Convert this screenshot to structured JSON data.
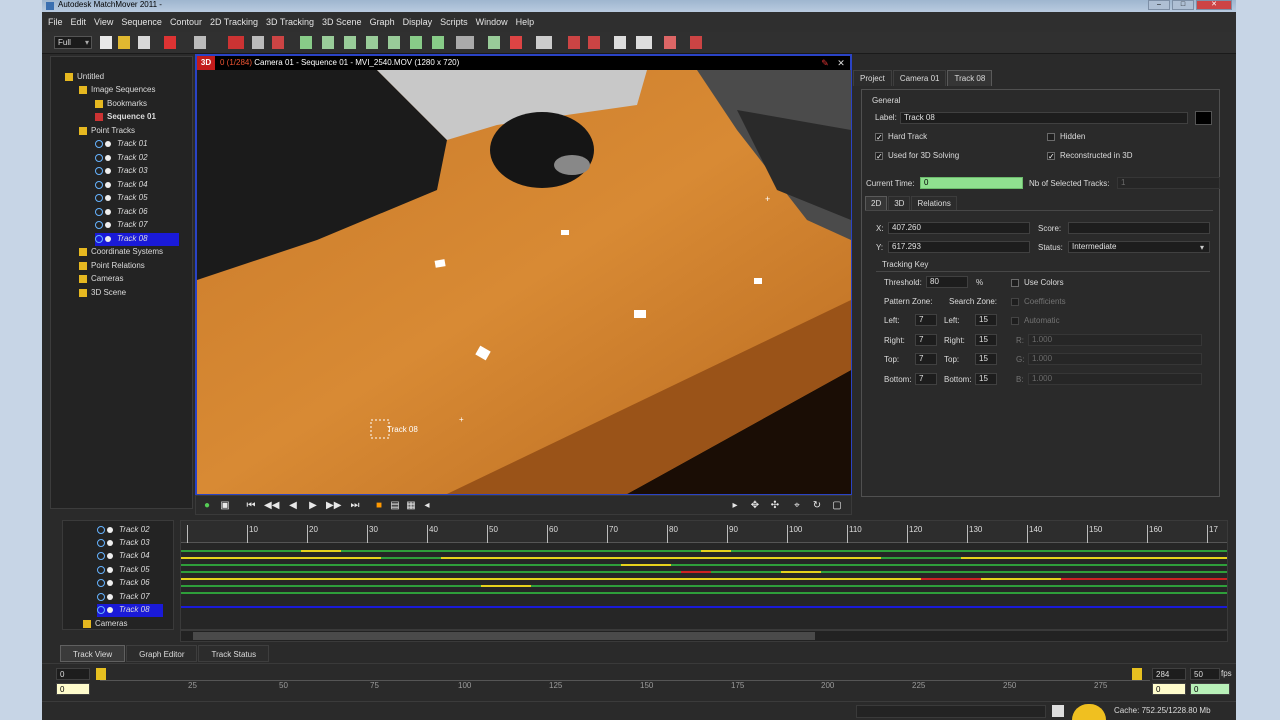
{
  "window": {
    "title": "Autodesk MatchMover 2011 -"
  },
  "menu": [
    "File",
    "Edit",
    "View",
    "Sequence",
    "Contour",
    "2D Tracking",
    "3D Tracking",
    "3D Scene",
    "Graph",
    "Display",
    "Scripts",
    "Window",
    "Help"
  ],
  "toolbar": {
    "zoom_value": "Full"
  },
  "tree": {
    "root": "Untitled",
    "image_sequences": "Image Sequences",
    "bookmarks": "Bookmarks",
    "sequence": "Sequence 01",
    "point_tracks": "Point Tracks",
    "tracks": [
      "Track 01",
      "Track 02",
      "Track 03",
      "Track 04",
      "Track 05",
      "Track 06",
      "Track 07",
      "Track 08"
    ],
    "coordinate_systems": "Coordinate Systems",
    "point_relations": "Point Relations",
    "cameras": "Cameras",
    "scene_3d": "3D Scene"
  },
  "viewport": {
    "badge": "3D",
    "frame": "0 (1/284)",
    "title": "Camera 01 - Sequence 01 - MVI_2540.MOV (1280 x 720)",
    "track_label": "Track 08"
  },
  "props": {
    "tabs": [
      "Project",
      "Camera 01",
      "Track 08"
    ],
    "active_tab": 2,
    "general": "General",
    "label_caption": "Label:",
    "label_value": "Track 08",
    "hard_track": "Hard Track",
    "hidden": "Hidden",
    "used_for_3d": "Used for 3D Solving",
    "reconstructed": "Reconstructed in 3D",
    "current_time_label": "Current Time:",
    "current_time_value": "0",
    "nb_selected_label": "Nb of Selected Tracks:",
    "nb_selected_value": "1",
    "subtabs": [
      "2D",
      "3D",
      "Relations"
    ],
    "x_label": "X:",
    "x_value": "407.260",
    "y_label": "Y:",
    "y_value": "617.293",
    "score_label": "Score:",
    "score_value": "",
    "status_label": "Status:",
    "status_value": "Intermediate",
    "tracking_key": "Tracking Key",
    "threshold_label": "Threshold:",
    "threshold_value": "80",
    "percent": "%",
    "use_colors": "Use Colors",
    "coefficients": "Coefficients",
    "automatic": "Automatic",
    "pattern_zone": "Pattern Zone:",
    "search_zone": "Search Zone:",
    "left": "Left:",
    "right": "Right:",
    "top": "Top:",
    "bottom": "Bottom:",
    "pattern": {
      "left": "7",
      "right": "7",
      "top": "7",
      "bottom": "7"
    },
    "search": {
      "left": "15",
      "right": "15",
      "top": "15",
      "bottom": "15"
    },
    "r_label": "R:",
    "g_label": "G:",
    "b_label": "B:",
    "r_value": "1.000",
    "g_value": "1.000",
    "b_value": "1.000"
  },
  "timeline": {
    "tracks": [
      "Track 02",
      "Track 03",
      "Track 04",
      "Track 05",
      "Track 06",
      "Track 07",
      "Track 08"
    ],
    "cameras": "Cameras",
    "ticks": [
      "10",
      "20",
      "30",
      "40",
      "50",
      "60",
      "70",
      "80",
      "90",
      "100",
      "110",
      "120",
      "130",
      "140",
      "150",
      "160",
      "17"
    ]
  },
  "bottom_tabs": [
    "Track View",
    "Graph Editor",
    "Track Status"
  ],
  "range": {
    "start_top": "0",
    "start_bottom": "0",
    "end_top": "284",
    "end_bottom": "0",
    "fps_value": "50",
    "fps_label": "fps",
    "fps_field": "0",
    "ticks": [
      "25",
      "50",
      "75",
      "100",
      "125",
      "150",
      "175",
      "200",
      "225",
      "250",
      "275"
    ]
  },
  "status": {
    "cache": "Cache: 752.25/1228.80 Mb"
  },
  "colors": {
    "selection": "#1a1ad8",
    "viewport_border": "#2a43c5",
    "track_green": "#2e9e3a",
    "track_yellow": "#e6d21c",
    "track_red": "#cc2222"
  }
}
